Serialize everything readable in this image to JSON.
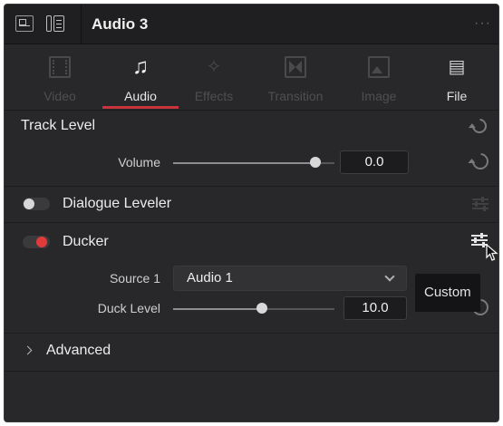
{
  "header": {
    "title": "Audio 3",
    "more_glyph": "···"
  },
  "tabs": [
    {
      "label": "Video",
      "icon": "video-icon",
      "state": "disabled"
    },
    {
      "label": "Audio",
      "icon": "music-note-icon",
      "state": "active"
    },
    {
      "label": "Effects",
      "icon": "magic-wand-icon",
      "state": "disabled"
    },
    {
      "label": "Transition",
      "icon": "transition-icon",
      "state": "disabled"
    },
    {
      "label": "Image",
      "icon": "image-icon",
      "state": "disabled"
    },
    {
      "label": "File",
      "icon": "file-icon",
      "state": "enabled"
    }
  ],
  "track_level": {
    "title": "Track Level",
    "volume_label": "Volume",
    "volume_value": "0.0",
    "volume_slider_fraction": 0.88
  },
  "dialogue_leveler": {
    "label": "Dialogue Leveler",
    "enabled": false
  },
  "ducker": {
    "label": "Ducker",
    "enabled": true,
    "source_label": "Source 1",
    "source_value": "Audio 1",
    "duck_level_label": "Duck Level",
    "duck_level_value": "10.0",
    "duck_level_slider_fraction": 0.55
  },
  "tooltip": {
    "text": "Custom"
  },
  "advanced": {
    "label": "Advanced"
  },
  "colors": {
    "panel_bg": "#28282b",
    "accent_red": "#c8343b",
    "toggle_on": "#e03a3a"
  }
}
